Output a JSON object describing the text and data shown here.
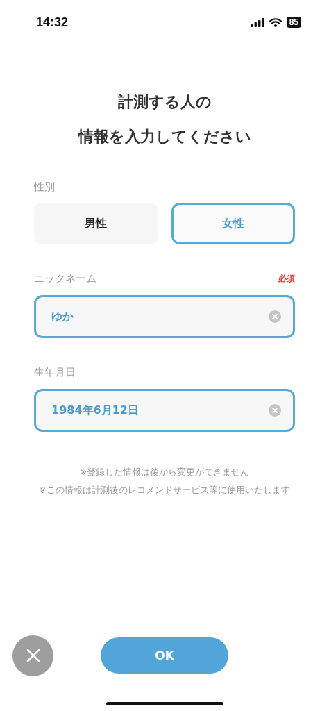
{
  "status_bar": {
    "time": "14:32",
    "battery": "85"
  },
  "title": [
    "計測する人の",
    "情報を入力してください"
  ],
  "gender": {
    "label": "性別",
    "options": [
      {
        "label": "男性",
        "selected": false
      },
      {
        "label": "女性",
        "selected": true
      }
    ]
  },
  "fields": [
    {
      "label": "ニックネーム",
      "required_badge": "必須",
      "value": "ゆか"
    },
    {
      "label": "生年月日",
      "value": "1984年6月12日"
    }
  ],
  "notes": [
    "※登録した情報は後から変更ができません",
    "※この情報は計測後のレコメンドサービス等に使用いたします"
  ],
  "ok_button": "OK"
}
